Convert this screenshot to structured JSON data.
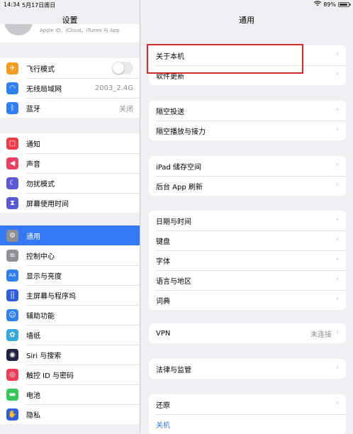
{
  "status_bar": {
    "time": "14:34",
    "date": "5月17日周日",
    "battery": "89%",
    "battery_level": 0.89
  },
  "sidebar": {
    "title": "设置",
    "profile_subtitle": "Apple ID、iCloud、iTunes 与 App",
    "groups": [
      [
        {
          "label": "飞行模式",
          "icon": "airplane-icon",
          "color": "#f39c1f",
          "glyph": "✈",
          "toggle": true,
          "toggle_on": false
        },
        {
          "label": "无线局域网",
          "icon": "wifi-icon",
          "color": "#2f7ff6",
          "glyph": "◠",
          "value": "2003_2.4G"
        },
        {
          "label": "蓝牙",
          "icon": "bluetooth-icon",
          "color": "#2f7ff6",
          "glyph": "ᛒ",
          "value": "关闭"
        }
      ],
      [
        {
          "label": "通知",
          "icon": "notifications-icon",
          "color": "#ef3b43",
          "glyph": "▢"
        },
        {
          "label": "声音",
          "icon": "sound-icon",
          "color": "#ee3f60",
          "glyph": "◀"
        },
        {
          "label": "勿扰模式",
          "icon": "moon-icon",
          "color": "#5b58d6",
          "glyph": "☾"
        },
        {
          "label": "屏幕使用时间",
          "icon": "hourglass-icon",
          "color": "#5b58d6",
          "glyph": "⧗"
        }
      ],
      [
        {
          "label": "通用",
          "icon": "gear-icon",
          "color": "#8e8e93",
          "glyph": "⚙",
          "selected": true
        },
        {
          "label": "控制中心",
          "icon": "control-center-icon",
          "color": "#8e8e93",
          "glyph": "≡"
        },
        {
          "label": "显示与亮度",
          "icon": "display-icon",
          "color": "#2f7ff6",
          "glyph": "AA"
        },
        {
          "label": "主屏幕与程序坞",
          "icon": "home-screen-icon",
          "color": "#2f5ee0",
          "glyph": "⣿"
        },
        {
          "label": "辅助功能",
          "icon": "accessibility-icon",
          "color": "#2f7ff6",
          "glyph": "☺"
        },
        {
          "label": "墙纸",
          "icon": "wallpaper-icon",
          "color": "#35aadc",
          "glyph": "✿"
        },
        {
          "label": "Siri 与搜索",
          "icon": "siri-icon",
          "color": "#222244",
          "glyph": "◉"
        },
        {
          "label": "触控 ID 与密码",
          "icon": "touch-id-icon",
          "color": "#ef3b55",
          "glyph": "◎"
        },
        {
          "label": "电池",
          "icon": "battery-icon",
          "color": "#34c759",
          "glyph": "▬"
        },
        {
          "label": "隐私",
          "icon": "privacy-hand-icon",
          "color": "#2f5ee0",
          "glyph": "✋"
        }
      ]
    ]
  },
  "detail": {
    "title": "通用",
    "groups": [
      [
        {
          "label": "关于本机"
        },
        {
          "label": "软件更新"
        }
      ],
      [
        {
          "label": "隔空投送"
        },
        {
          "label": "隔空播放与接力"
        }
      ],
      [
        {
          "label": "iPad 储存空间"
        },
        {
          "label": "后台 App 刷新"
        }
      ],
      [
        {
          "label": "日期与时间"
        },
        {
          "label": "键盘"
        },
        {
          "label": "字体"
        },
        {
          "label": "语言与地区"
        },
        {
          "label": "词典"
        }
      ],
      [
        {
          "label": "VPN",
          "value": "未连接"
        }
      ],
      [
        {
          "label": "法律与监管"
        }
      ],
      [
        {
          "label": "还原"
        },
        {
          "label": "关机",
          "blue": true,
          "no_chevron": true
        }
      ]
    ]
  }
}
